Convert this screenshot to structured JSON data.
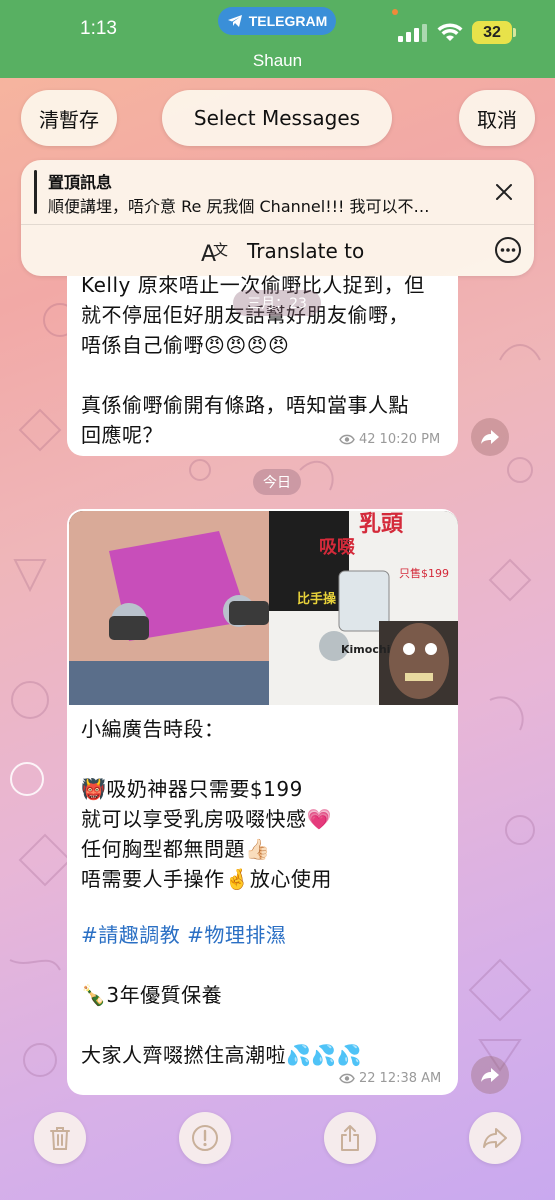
{
  "status": {
    "time": "1:13",
    "app_pill": "TELEGRAM",
    "battery": "32",
    "contact": "Shaun"
  },
  "header": {
    "left_button": "清暫存",
    "title_button": "Select Messages",
    "right_button": "取消"
  },
  "pinned": {
    "title": "置頂訊息",
    "text": "順便講埋，唔介意 Re 尻我個 Channel!!! 我可以不…",
    "translate_label": "Translate to"
  },
  "messages": [
    {
      "date_pill": "三月：23",
      "text": "Kelly 原來唔止一次偷嘢比人捉到，但\n就不停屈佢好朋友話幫好朋友偷嘢，\n唔係自己偷嘢😠😠😠😠\n\n真係偷嘢偷開有條路，唔知當事人點\n回應呢？",
      "views": "42",
      "time": "10:20 PM"
    },
    {
      "date_pill": "今日",
      "caption": "小編廣告時段：\n\n👹吸奶神器只需要$199\n就可以享受乳房吸啜快感💗\n任何胸型都無問題👍🏻\n唔需要人手操作🤞放心使用",
      "hashtags": "#請趣調教 #物理排濕",
      "caption2": "🍾3年優質保養\n\n大家人齊啜撚住高潮啦💦💦💦",
      "views": "22",
      "time": "12:38 AM",
      "image_texts": {
        "red_big": "乳頭",
        "red_side": "吸啜",
        "free_hands": "比手操",
        "price": "只售$199",
        "kimochi": "Kimochi"
      }
    }
  ],
  "icons": {
    "translate": "translate-icon",
    "more": "ellipsis-circle-icon",
    "close": "close-icon",
    "eye": "eye-icon",
    "forward": "forward-arrow-icon",
    "trash": "trash-icon",
    "report": "exclamation-circle-icon",
    "share": "share-icon",
    "forward_bottom": "forward-icon"
  },
  "colors": {
    "status_bar": "#58b062",
    "telegram_pill": "#3a8fd8",
    "battery": "#e8e24a",
    "hashtag": "#2a6fc4"
  }
}
